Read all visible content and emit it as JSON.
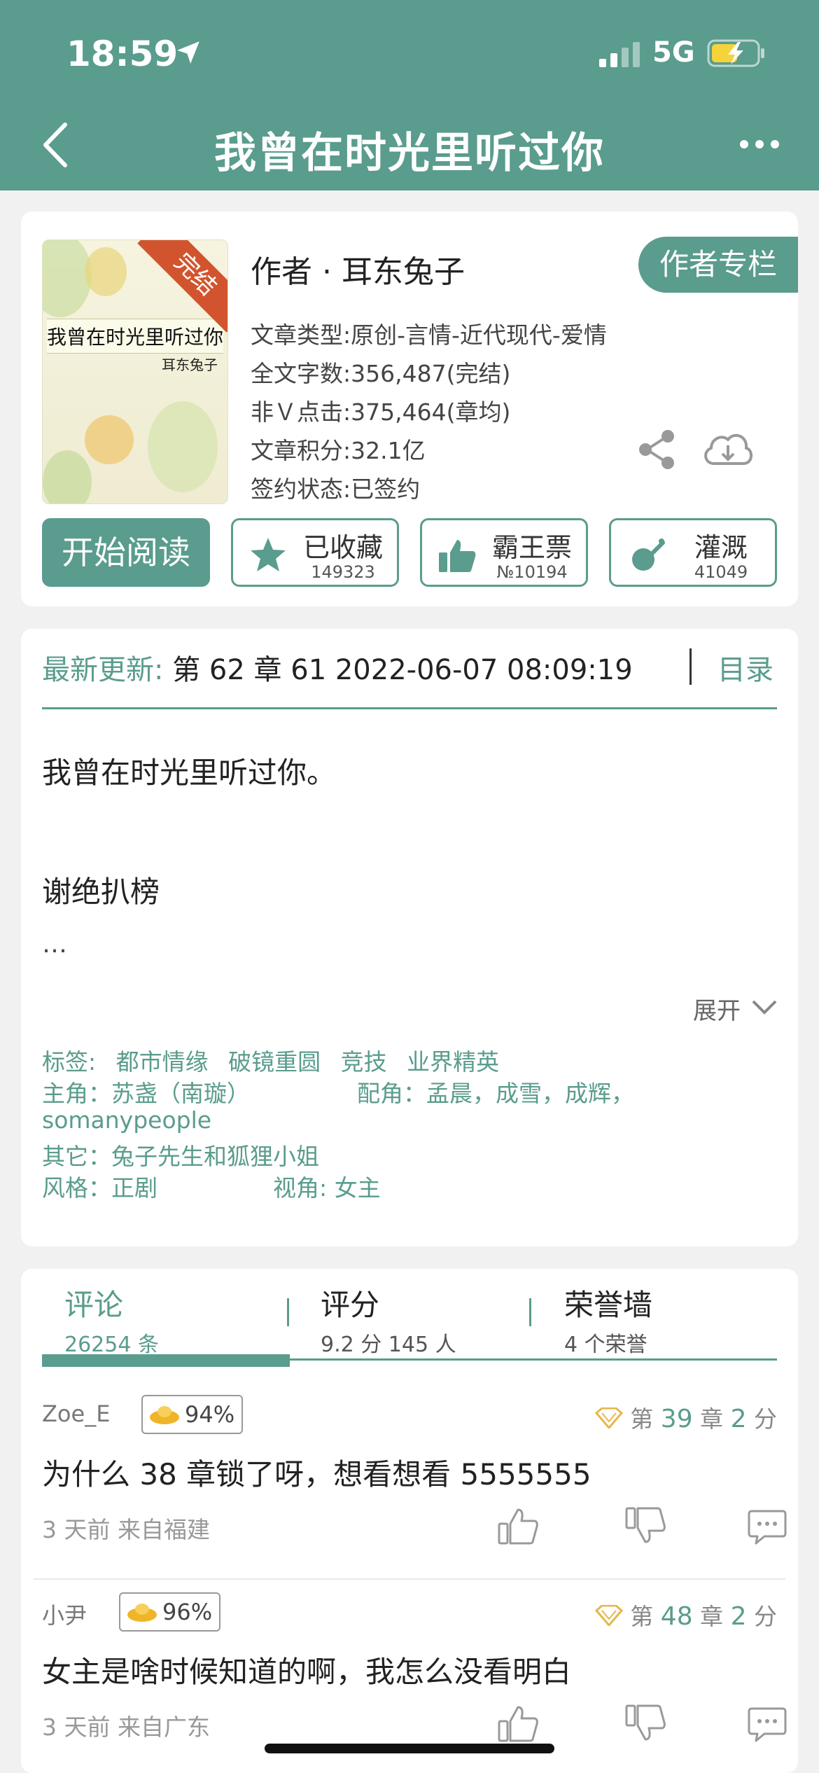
{
  "status": {
    "time": "18:59",
    "network": "5G"
  },
  "nav": {
    "title": "我曾在时光里听过你"
  },
  "book": {
    "cover": {
      "title": "我曾在时光里听过你",
      "author": "耳东兔子",
      "ribbon": "完结"
    },
    "author_line": "作者 · 耳东兔子",
    "author_column": "作者专栏",
    "type": "文章类型:原创-言情-近代现代-爱情",
    "words": "全文字数:356,487(完结)",
    "clicks": "非Ｖ点击:375,464(章均)",
    "score": "文章积分:32.1亿",
    "sign": "签约状态:已签约"
  },
  "actions": {
    "start": "开始阅读",
    "collect": {
      "label": "已收藏",
      "count": "149323"
    },
    "ticket": {
      "label": "霸王票",
      "count": "№10194"
    },
    "water": {
      "label": "灌溉",
      "count": "41049"
    }
  },
  "latest": {
    "label": "最新更新:",
    "value": " 第 62 章 61 2022-06-07 08:09:19",
    "toc": "目录"
  },
  "description": {
    "line1": "我曾在时光里听过你。",
    "line2": "谢绝扒榜",
    "line3": "…",
    "expand": "展开"
  },
  "tags": {
    "label": "标签:",
    "items": [
      "都市情缘",
      "破镜重圆",
      "竞技",
      "业界精英"
    ],
    "lead": "主角：苏盏（南璇）",
    "support": "配角：孟晨，成雪，成辉，",
    "support_cont": "somanypeople",
    "other": "其它：兔子先生和狐狸小姐",
    "style": "风格：正剧",
    "view": "视角: 女主"
  },
  "tabs": [
    {
      "title": "评论",
      "sub": "26254 条"
    },
    {
      "title": "评分",
      "sub": "9.2 分 145 人"
    },
    {
      "title": "荣誉墙",
      "sub": "4 个荣誉"
    }
  ],
  "comments": [
    {
      "user": "Zoe_E",
      "score": "94%",
      "chap_pre": "第 ",
      "chap_no": "39",
      "chap_mid": " 章 ",
      "chap_pts": "2",
      "chap_post": " 分",
      "text": "为什么 38 章锁了呀，想看想看 5555555",
      "meta": "3 天前   来自福建"
    },
    {
      "user": "小尹",
      "score": "96%",
      "chap_pre": "第 ",
      "chap_no": "48",
      "chap_mid": " 章 ",
      "chap_pts": "2",
      "chap_post": " 分",
      "text": "女主是啥时候知道的啊，我怎么没看明白",
      "meta": "3 天前   来自广东"
    }
  ],
  "colors": {
    "accent": "#5a9c8d",
    "ribbon": "#d2542e"
  }
}
